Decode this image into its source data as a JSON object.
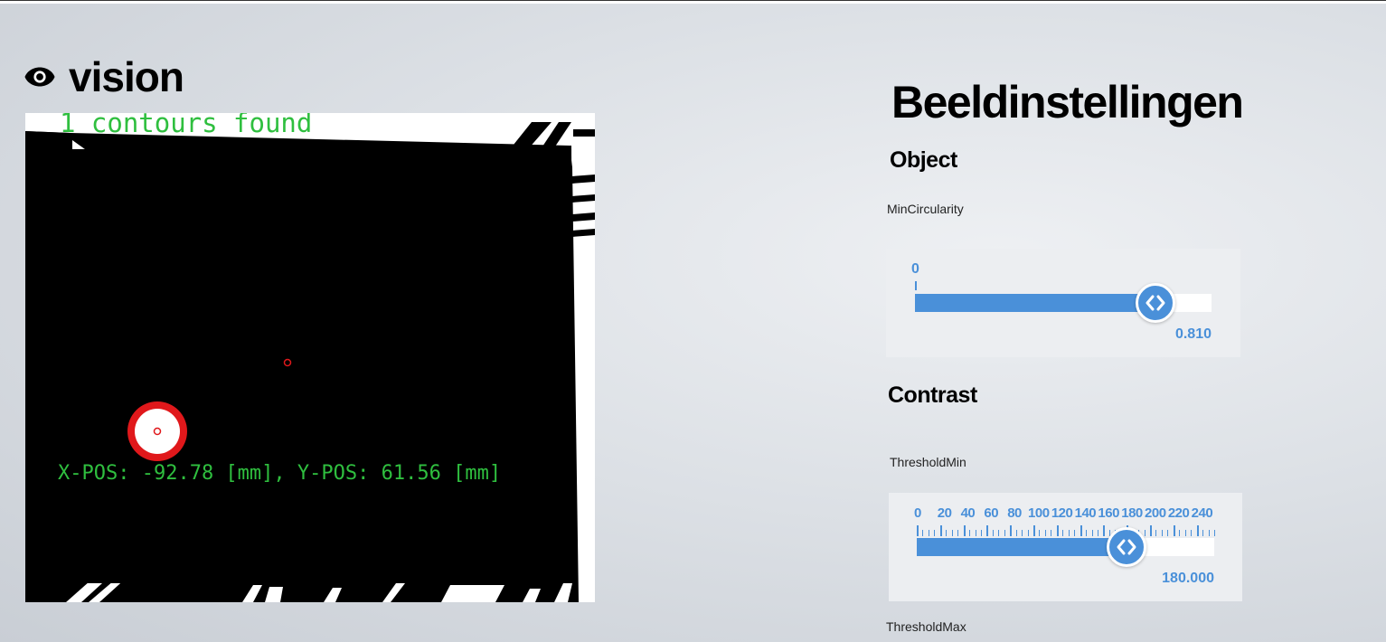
{
  "app": {
    "title": "vision",
    "title_icon": "eye-icon"
  },
  "camera": {
    "contours_text": "1 contours found",
    "position_text": "X-POS: -92.78 [mm], Y-POS: 61.56 [mm]",
    "text_color": "#2fbf3f",
    "marker_color": "#e0181b"
  },
  "settings": {
    "title": "Beeldinstellingen",
    "sections": [
      {
        "title": "Object",
        "params": [
          {
            "label": "MinCircularity",
            "min": 0,
            "max": 1,
            "value": 0.81,
            "display_value": "0.810",
            "tick_labels": [
              "0"
            ]
          }
        ]
      },
      {
        "title": "Contrast",
        "params": [
          {
            "label": "ThresholdMin",
            "min": 0,
            "max": 255,
            "value": 180,
            "display_value": "180.000",
            "tick_labels": [
              "0",
              "20",
              "40",
              "60",
              "80",
              "100",
              "120",
              "140",
              "160",
              "180",
              "200",
              "220",
              "240"
            ]
          },
          {
            "label": "ThresholdMax"
          }
        ]
      }
    ]
  },
  "colors": {
    "accent": "#4a90d9",
    "panel": "#eceef1"
  }
}
